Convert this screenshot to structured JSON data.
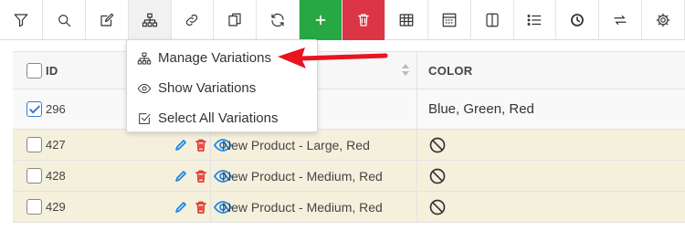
{
  "toolbar": {
    "buttons": [
      {
        "icon": "filter-icon"
      },
      {
        "icon": "search-icon"
      },
      {
        "icon": "edit-icon"
      },
      {
        "icon": "sitemap-icon"
      },
      {
        "icon": "link-icon"
      },
      {
        "icon": "copy-icon"
      },
      {
        "icon": "refresh-icon"
      },
      {
        "icon": "plus-icon",
        "color": "#28a745"
      },
      {
        "icon": "trash-icon",
        "color": "#dc3545"
      },
      {
        "icon": "table-icon"
      },
      {
        "icon": "calculator-icon"
      },
      {
        "icon": "columns-icon"
      },
      {
        "icon": "list-icon"
      },
      {
        "icon": "clock-icon"
      },
      {
        "icon": "exchange-icon"
      },
      {
        "icon": "gear-icon"
      }
    ]
  },
  "dropdown": {
    "items": [
      {
        "label": "Manage Variations",
        "icon": "sitemap-icon"
      },
      {
        "label": "Show Variations",
        "icon": "eye-icon"
      },
      {
        "label": "Select All Variations",
        "icon": "check-square-icon"
      }
    ]
  },
  "grid": {
    "headers": {
      "id": "ID",
      "color": "COLOR"
    },
    "parent": {
      "id": "296",
      "checked": true,
      "color": "Blue, Green, Red"
    },
    "variations": [
      {
        "id": "427",
        "name": "New Product - Large, Red"
      },
      {
        "id": "428",
        "name": "New Product - Medium, Red"
      },
      {
        "id": "429",
        "name": "New Product - Medium, Red"
      }
    ]
  },
  "colors": {
    "add": "#28a745",
    "delete": "#dc3545",
    "variation_row": "#f5f0dc",
    "annotation_arrow": "#e8141e",
    "icon_blue": "#1e88e5"
  }
}
